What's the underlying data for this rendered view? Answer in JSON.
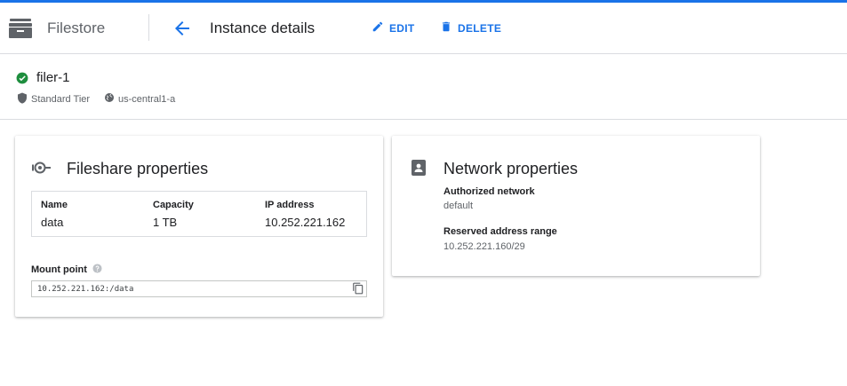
{
  "header": {
    "product_name": "Filestore",
    "page_title": "Instance details",
    "edit_label": "EDIT",
    "delete_label": "DELETE",
    "accent_color": "#1a73e8"
  },
  "instance": {
    "name": "filer-1",
    "status": "ready",
    "status_color": "#1e8e3e",
    "tier": "Standard Tier",
    "zone": "us-central1-a"
  },
  "fileshare": {
    "title": "Fileshare properties",
    "columns": [
      {
        "header": "Name",
        "value": "data"
      },
      {
        "header": "Capacity",
        "value": "1 TB"
      },
      {
        "header": "IP address",
        "value": "10.252.221.162"
      }
    ],
    "mount_point_label": "Mount point",
    "mount_point_value": "10.252.221.162:/data"
  },
  "network": {
    "title": "Network properties",
    "authorized_network_label": "Authorized network",
    "authorized_network_value": "default",
    "reserved_range_label": "Reserved address range",
    "reserved_range_value": "10.252.221.160/29"
  }
}
